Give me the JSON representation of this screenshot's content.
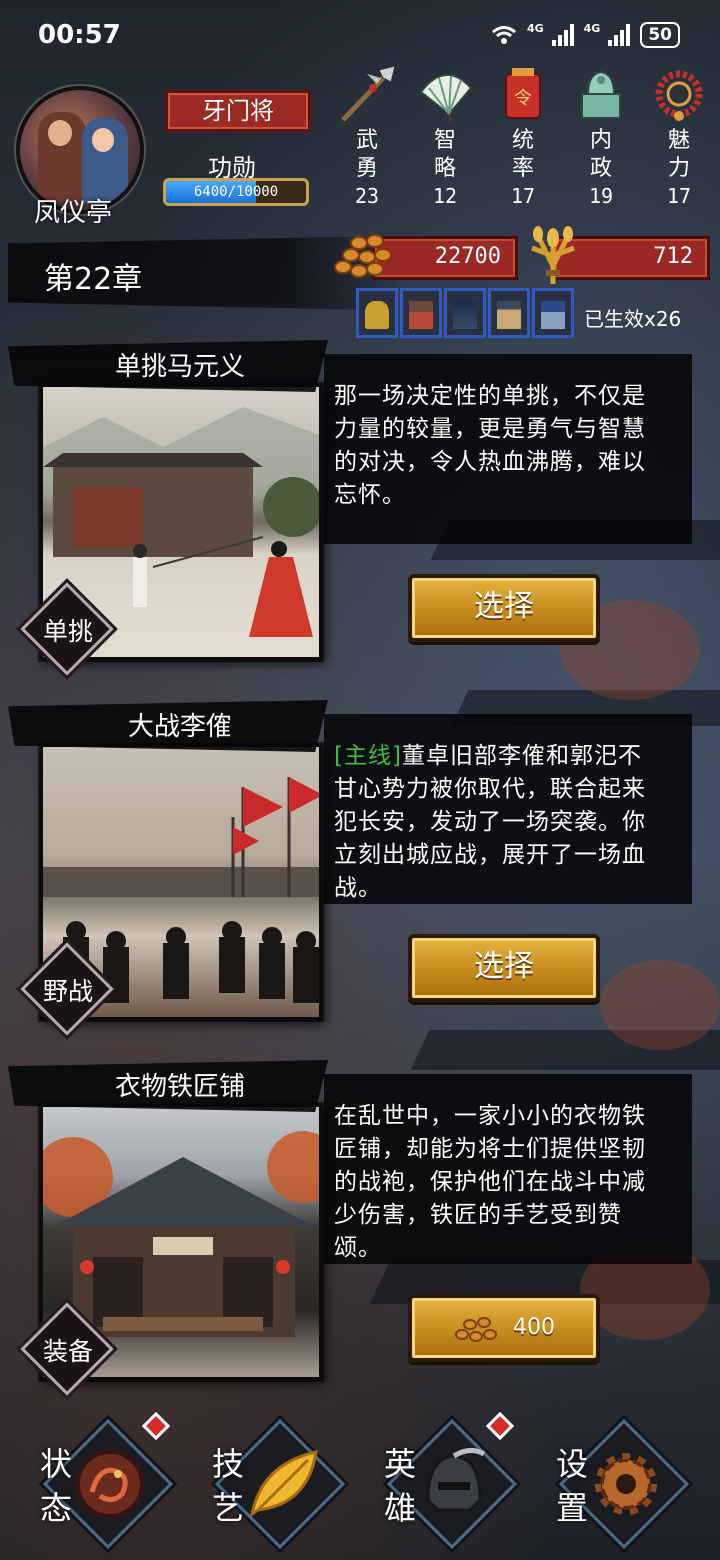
{
  "status_bar": {
    "time": "00:57",
    "network_1": "4G",
    "network_2": "4G",
    "battery": "50"
  },
  "player": {
    "name": "凤仪亭",
    "rank": "牙门将",
    "merit_label": "功勋",
    "merit_text": "6400/10000",
    "merit_progress": 0.64
  },
  "stats": [
    {
      "label_top": "武",
      "label_bottom": "勇",
      "value": "23",
      "icon": "halberd-icon"
    },
    {
      "label_top": "智",
      "label_bottom": "略",
      "value": "12",
      "icon": "fan-icon"
    },
    {
      "label_top": "统",
      "label_bottom": "率",
      "value": "17",
      "icon": "token-icon"
    },
    {
      "label_top": "内",
      "label_bottom": "政",
      "value": "19",
      "icon": "seal-icon"
    },
    {
      "label_top": "魅",
      "label_bottom": "力",
      "value": "17",
      "icon": "necklace-icon"
    }
  ],
  "chapter": {
    "title": "第22章"
  },
  "resources": {
    "coins": "22700",
    "grain": "712"
  },
  "buffs": {
    "count_text": "已生效x26",
    "items": [
      "warrior-buff-icon",
      "building-buff-icon",
      "night-buff-icon",
      "tower-buff-icon",
      "palace-buff-icon"
    ]
  },
  "events": [
    {
      "title": "单挑马元义",
      "type": "单挑",
      "tag": "",
      "description": "那一场决定性的单挑，不仅是力量的较量，更是勇气与智慧的对决，令人热血沸腾，难以忘怀。",
      "button": "选择"
    },
    {
      "title": "大战李傕",
      "type": "野战",
      "tag": "[主线]",
      "description": "董卓旧部李傕和郭汜不甘心势力被你取代，联合起来犯长安，发动了一场突袭。你立刻出城应战，展开了一场血战。",
      "button": "选择"
    },
    {
      "title": "衣物铁匠铺",
      "type": "装备",
      "tag": "",
      "description": "在乱世中，一家小小的衣物铁匠铺，却能为将士们提供坚韧的战袍，保护他们在战斗中减少伤害，铁匠的手艺受到赞颂。",
      "button": "400"
    }
  ],
  "nav": [
    {
      "label": "状态",
      "icon": "dragon-medallion-icon",
      "badge": true
    },
    {
      "label": "技艺",
      "icon": "golden-leaf-icon",
      "badge": false
    },
    {
      "label": "英雄",
      "icon": "helmet-icon",
      "badge": true
    },
    {
      "label": "设置",
      "icon": "gear-icon",
      "badge": false
    }
  ],
  "colors": {
    "badge_red": "#9c2a24",
    "button_gold": "#e6b446",
    "main_tag_green": "#3fbf3f",
    "merit_blue": "#48a8ff"
  }
}
